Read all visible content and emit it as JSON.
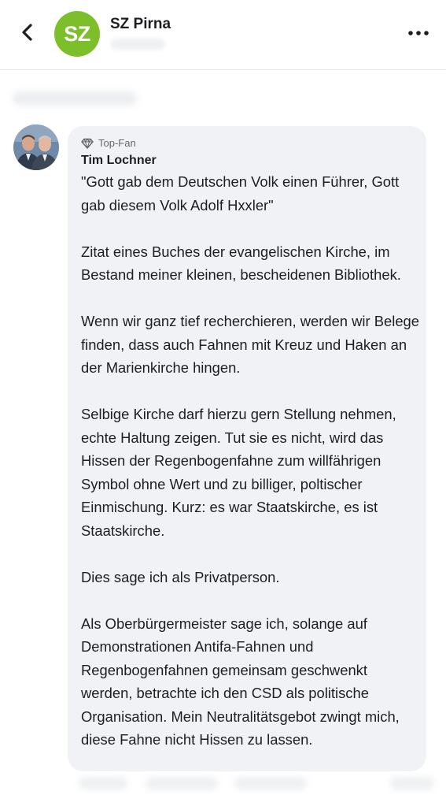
{
  "header": {
    "page_name": "SZ Pirna",
    "logo_text": "SZ",
    "logo_color": "#7cbf2b",
    "back_icon": "chevron-left-icon",
    "more_icon": "more-horizontal-icon"
  },
  "comment": {
    "badge_icon": "diamond-icon",
    "badge": "Top-Fan",
    "author": "Tim Lochner",
    "paragraphs": [
      "\"Gott gab dem Deutschen Volk einen Führer, Gott gab diesem Volk Adolf Hxxler\"",
      "Zitat eines Buches der evangelischen Kirche, im Bestand meiner kleinen, bescheidenen Bibliothek.",
      "Wenn wir ganz tief recherchieren, werden wir Belege finden, dass auch Fahnen mit Kreuz und Haken an der Marienkirche hingen.",
      "Selbige Kirche darf hierzu gern Stellung nehmen, echte Haltung zeigen. Tut sie es nicht, wird das Hissen der Regenbogenfahne zum willfährigen Symbol ohne Wert und zu billiger, poltischer Einmischung. Kurz: es war Staatskirche, es ist Staatskirche.",
      "Dies sage ich als Privatperson.",
      "Als Oberbürgermeister sage ich, solange auf Demonstrationen Antifa-Fahnen und Regenbogenfahnen gemeinsam geschwenkt werden, betrachte ich den CSD als politische Organisation. Mein Neutralitätsgebot zwingt mich, diese Fahne nicht Hissen zu lassen."
    ]
  }
}
